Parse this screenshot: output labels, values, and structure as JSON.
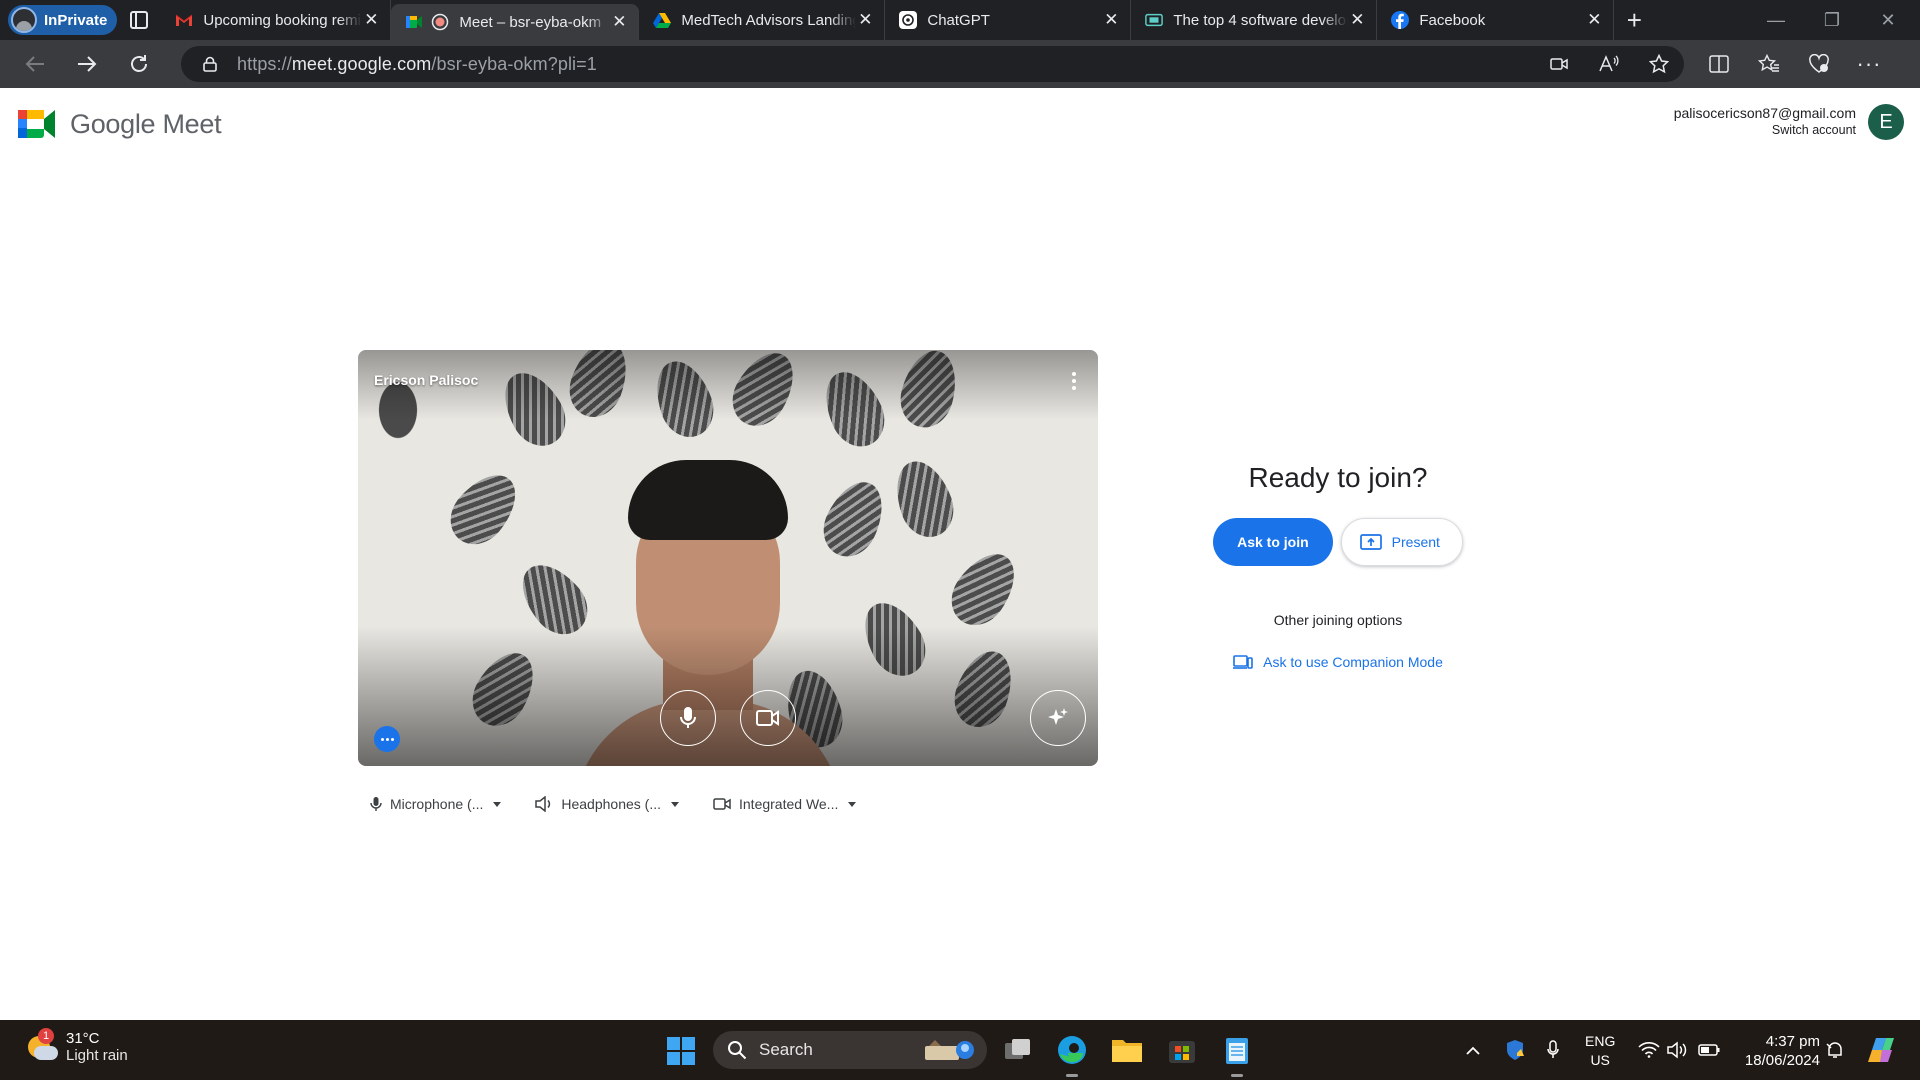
{
  "browser": {
    "inprivate_label": "InPrivate",
    "tabs": [
      {
        "title": "Upcoming booking reminder",
        "favicon": "gmail-icon"
      },
      {
        "title": "Meet – bsr-eyba-okm",
        "favicon": "meet-icon",
        "active": true
      },
      {
        "title": "MedTech Advisors Landing",
        "favicon": "drive-icon"
      },
      {
        "title": "ChatGPT",
        "favicon": "chatgpt-icon"
      },
      {
        "title": "The top 4 software developers",
        "favicon": "generic-icon"
      },
      {
        "title": "Facebook",
        "favicon": "facebook-icon"
      }
    ],
    "url_prefix": "https://",
    "url_host": "meet.google.com",
    "url_path": "/bsr-eyba-okm?pli=1"
  },
  "meet": {
    "brand": "Google Meet",
    "account_email": "palisocericson87@gmail.com",
    "switch_account": "Switch account",
    "avatar_initial": "E",
    "preview_name": "Ericson Palisoc",
    "devices": {
      "microphone": "Microphone (...",
      "speaker": "Headphones (...",
      "camera": "Integrated We..."
    },
    "ready_title": "Ready to join?",
    "ask_to_join": "Ask to join",
    "present": "Present",
    "other_options": "Other joining options",
    "companion": "Ask to use Companion Mode"
  },
  "taskbar": {
    "temp": "31°C",
    "condition": "Light rain",
    "weather_badge": "1",
    "search": "Search",
    "lang_top": "ENG",
    "lang_bottom": "US",
    "time": "4:37 pm",
    "date": "18/06/2024"
  },
  "colors": {
    "accent": "#1a73e8",
    "avatar": "#1b5e4a",
    "tabstrip": "#202124",
    "toolbar": "#3a3b3e"
  }
}
